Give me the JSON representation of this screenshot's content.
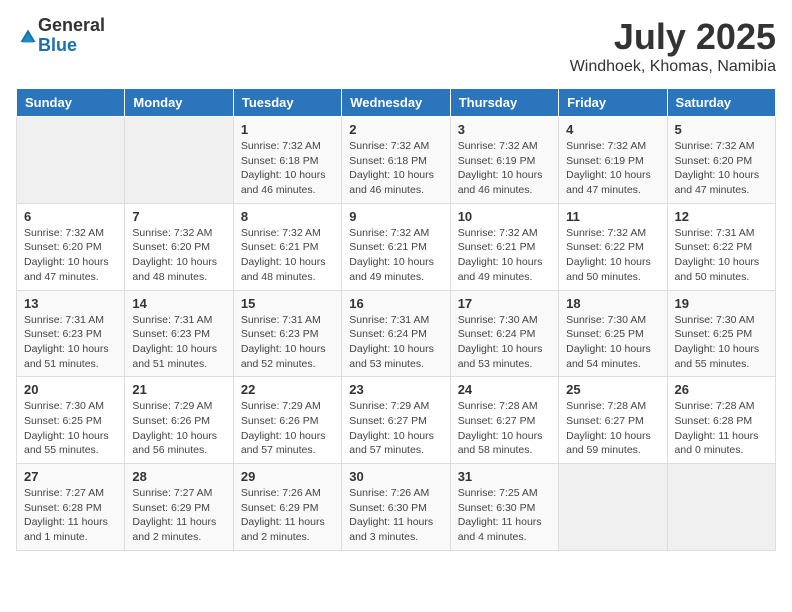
{
  "header": {
    "logo_general": "General",
    "logo_blue": "Blue",
    "month_year": "July 2025",
    "location": "Windhoek, Khomas, Namibia"
  },
  "days_of_week": [
    "Sunday",
    "Monday",
    "Tuesday",
    "Wednesday",
    "Thursday",
    "Friday",
    "Saturday"
  ],
  "weeks": [
    [
      {
        "day": "",
        "info": ""
      },
      {
        "day": "",
        "info": ""
      },
      {
        "day": "1",
        "info": "Sunrise: 7:32 AM\nSunset: 6:18 PM\nDaylight: 10 hours and 46 minutes."
      },
      {
        "day": "2",
        "info": "Sunrise: 7:32 AM\nSunset: 6:18 PM\nDaylight: 10 hours and 46 minutes."
      },
      {
        "day": "3",
        "info": "Sunrise: 7:32 AM\nSunset: 6:19 PM\nDaylight: 10 hours and 46 minutes."
      },
      {
        "day": "4",
        "info": "Sunrise: 7:32 AM\nSunset: 6:19 PM\nDaylight: 10 hours and 47 minutes."
      },
      {
        "day": "5",
        "info": "Sunrise: 7:32 AM\nSunset: 6:20 PM\nDaylight: 10 hours and 47 minutes."
      }
    ],
    [
      {
        "day": "6",
        "info": "Sunrise: 7:32 AM\nSunset: 6:20 PM\nDaylight: 10 hours and 47 minutes."
      },
      {
        "day": "7",
        "info": "Sunrise: 7:32 AM\nSunset: 6:20 PM\nDaylight: 10 hours and 48 minutes."
      },
      {
        "day": "8",
        "info": "Sunrise: 7:32 AM\nSunset: 6:21 PM\nDaylight: 10 hours and 48 minutes."
      },
      {
        "day": "9",
        "info": "Sunrise: 7:32 AM\nSunset: 6:21 PM\nDaylight: 10 hours and 49 minutes."
      },
      {
        "day": "10",
        "info": "Sunrise: 7:32 AM\nSunset: 6:21 PM\nDaylight: 10 hours and 49 minutes."
      },
      {
        "day": "11",
        "info": "Sunrise: 7:32 AM\nSunset: 6:22 PM\nDaylight: 10 hours and 50 minutes."
      },
      {
        "day": "12",
        "info": "Sunrise: 7:31 AM\nSunset: 6:22 PM\nDaylight: 10 hours and 50 minutes."
      }
    ],
    [
      {
        "day": "13",
        "info": "Sunrise: 7:31 AM\nSunset: 6:23 PM\nDaylight: 10 hours and 51 minutes."
      },
      {
        "day": "14",
        "info": "Sunrise: 7:31 AM\nSunset: 6:23 PM\nDaylight: 10 hours and 51 minutes."
      },
      {
        "day": "15",
        "info": "Sunrise: 7:31 AM\nSunset: 6:23 PM\nDaylight: 10 hours and 52 minutes."
      },
      {
        "day": "16",
        "info": "Sunrise: 7:31 AM\nSunset: 6:24 PM\nDaylight: 10 hours and 53 minutes."
      },
      {
        "day": "17",
        "info": "Sunrise: 7:30 AM\nSunset: 6:24 PM\nDaylight: 10 hours and 53 minutes."
      },
      {
        "day": "18",
        "info": "Sunrise: 7:30 AM\nSunset: 6:25 PM\nDaylight: 10 hours and 54 minutes."
      },
      {
        "day": "19",
        "info": "Sunrise: 7:30 AM\nSunset: 6:25 PM\nDaylight: 10 hours and 55 minutes."
      }
    ],
    [
      {
        "day": "20",
        "info": "Sunrise: 7:30 AM\nSunset: 6:25 PM\nDaylight: 10 hours and 55 minutes."
      },
      {
        "day": "21",
        "info": "Sunrise: 7:29 AM\nSunset: 6:26 PM\nDaylight: 10 hours and 56 minutes."
      },
      {
        "day": "22",
        "info": "Sunrise: 7:29 AM\nSunset: 6:26 PM\nDaylight: 10 hours and 57 minutes."
      },
      {
        "day": "23",
        "info": "Sunrise: 7:29 AM\nSunset: 6:27 PM\nDaylight: 10 hours and 57 minutes."
      },
      {
        "day": "24",
        "info": "Sunrise: 7:28 AM\nSunset: 6:27 PM\nDaylight: 10 hours and 58 minutes."
      },
      {
        "day": "25",
        "info": "Sunrise: 7:28 AM\nSunset: 6:27 PM\nDaylight: 10 hours and 59 minutes."
      },
      {
        "day": "26",
        "info": "Sunrise: 7:28 AM\nSunset: 6:28 PM\nDaylight: 11 hours and 0 minutes."
      }
    ],
    [
      {
        "day": "27",
        "info": "Sunrise: 7:27 AM\nSunset: 6:28 PM\nDaylight: 11 hours and 1 minute."
      },
      {
        "day": "28",
        "info": "Sunrise: 7:27 AM\nSunset: 6:29 PM\nDaylight: 11 hours and 2 minutes."
      },
      {
        "day": "29",
        "info": "Sunrise: 7:26 AM\nSunset: 6:29 PM\nDaylight: 11 hours and 2 minutes."
      },
      {
        "day": "30",
        "info": "Sunrise: 7:26 AM\nSunset: 6:30 PM\nDaylight: 11 hours and 3 minutes."
      },
      {
        "day": "31",
        "info": "Sunrise: 7:25 AM\nSunset: 6:30 PM\nDaylight: 11 hours and 4 minutes."
      },
      {
        "day": "",
        "info": ""
      },
      {
        "day": "",
        "info": ""
      }
    ]
  ]
}
